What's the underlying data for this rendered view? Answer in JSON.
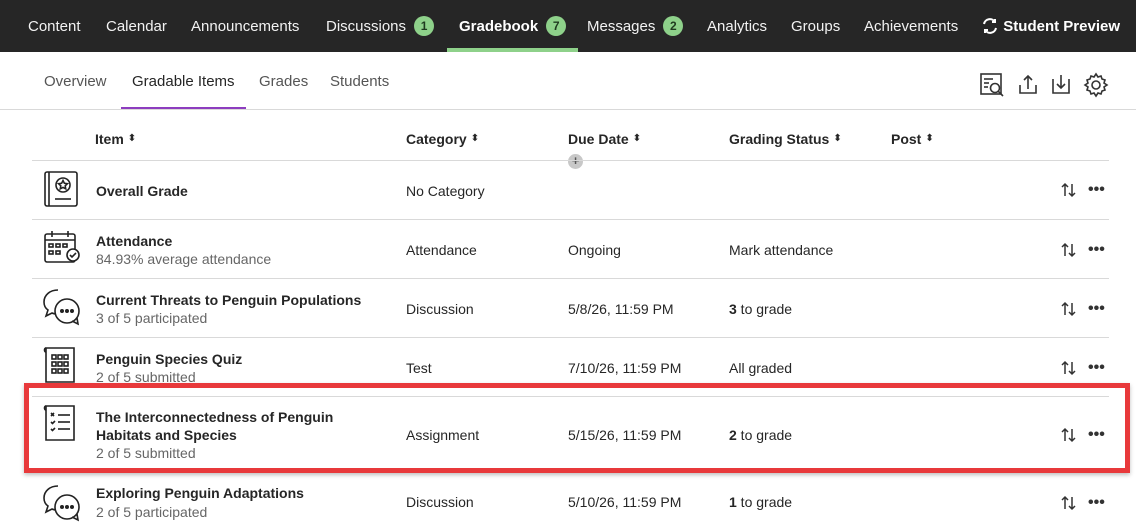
{
  "topnav": {
    "items": [
      {
        "label": "Content"
      },
      {
        "label": "Calendar"
      },
      {
        "label": "Announcements"
      },
      {
        "label": "Discussions",
        "badge": "1"
      },
      {
        "label": "Gradebook",
        "badge": "7",
        "active": true
      },
      {
        "label": "Messages",
        "badge": "2"
      },
      {
        "label": "Analytics"
      },
      {
        "label": "Groups"
      },
      {
        "label": "Achievements"
      }
    ],
    "student_preview": "Student Preview",
    "badge_color": "#8ed18a"
  },
  "subtabs": {
    "items": [
      {
        "label": "Overview"
      },
      {
        "label": "Gradable Items",
        "active": true
      },
      {
        "label": "Grades"
      },
      {
        "label": "Students"
      }
    ],
    "active_color": "#8d3dbf",
    "tools": [
      "search-grades-icon",
      "upload-icon",
      "download-icon",
      "settings-gear-icon"
    ]
  },
  "table": {
    "headers": {
      "item": "Item",
      "category": "Category",
      "due_date": "Due Date",
      "grading_status": "Grading Status",
      "post": "Post"
    },
    "rows": [
      {
        "icon": "overall-grade-icon",
        "title": "Overall Grade",
        "sub": "",
        "category": "No Category",
        "due": "",
        "status_num": "",
        "status_text": ""
      },
      {
        "icon": "attendance-calendar-icon",
        "title": "Attendance",
        "sub": "84.93% average attendance",
        "category": "Attendance",
        "due": "Ongoing",
        "status_num": "",
        "status_text": "Mark attendance"
      },
      {
        "icon": "discussion-icon",
        "title": "Current Threats to Penguin Populations",
        "sub": "3 of 5 participated",
        "category": "Discussion",
        "due": "5/8/26, 11:59 PM",
        "status_num": "3",
        "status_text": " to grade"
      },
      {
        "icon": "test-icon",
        "title": "Penguin Species Quiz",
        "sub": "2 of 5 submitted",
        "category": "Test",
        "due": "7/10/26, 11:59 PM",
        "status_num": "",
        "status_text": "All graded"
      },
      {
        "icon": "assignment-icon",
        "title": "The Interconnectedness of Penguin",
        "title2": "Habitats and Species",
        "sub": "2 of 5 submitted",
        "category": "Assignment",
        "due": "5/15/26, 11:59 PM",
        "status_num": "2",
        "status_text": " to grade"
      },
      {
        "icon": "discussion-icon",
        "title": "Exploring Penguin Adaptations",
        "sub": "2 of 5 participated",
        "category": "Discussion",
        "due": "5/10/26, 11:59 PM",
        "status_num": "1",
        "status_text": " to grade"
      }
    ]
  },
  "highlight_color": "#e8393b"
}
